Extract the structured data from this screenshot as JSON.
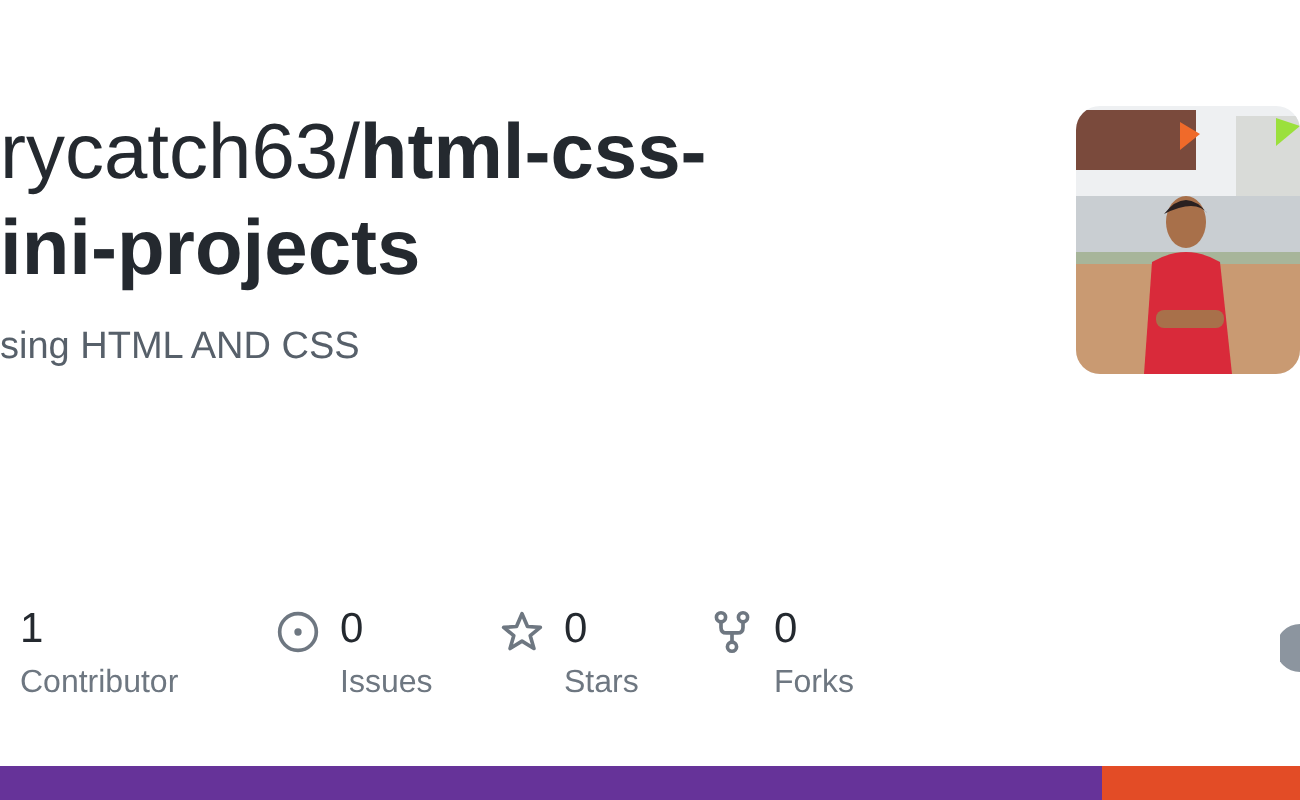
{
  "title_lines": [
    "rycatch63/**html-css-**",
    "ini-projects"
  ],
  "description": "sing HTML AND CSS",
  "stats": [
    {
      "kind": "plain",
      "count": "1",
      "label": "Contributor"
    },
    {
      "kind": "issue",
      "count": "0",
      "label": "Issues"
    },
    {
      "kind": "star",
      "count": "0",
      "label": "Stars"
    },
    {
      "kind": "fork",
      "count": "0",
      "label": "Forks"
    }
  ],
  "language_bar": [
    {
      "color": "#663399",
      "level": 0.848
    },
    {
      "color": "#e34c26",
      "level": 0.152
    }
  ]
}
